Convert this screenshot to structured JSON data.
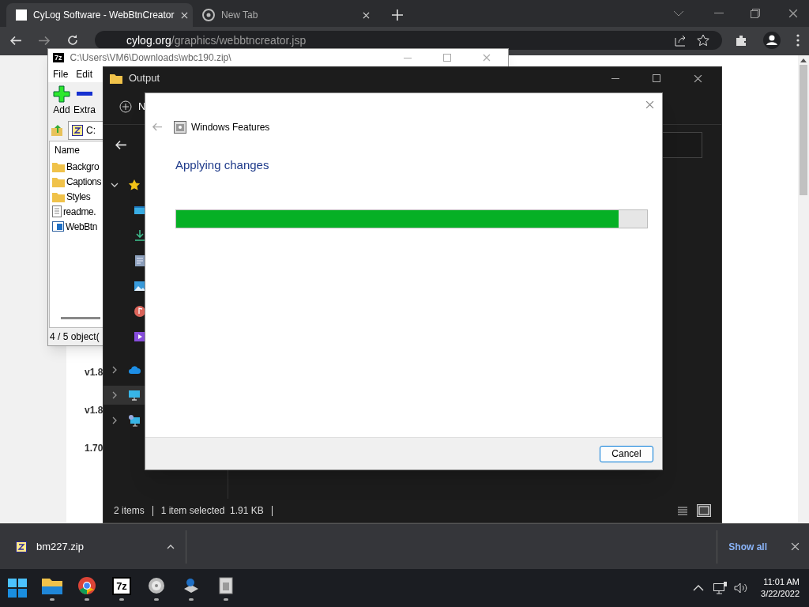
{
  "browser": {
    "tabs": [
      {
        "title": "CyLog Software - WebBtnCreator",
        "selected": true
      },
      {
        "title": "New Tab",
        "selected": false
      }
    ],
    "url_host": "cylog.org",
    "url_path": "/graphics/webbtncreator.jsp",
    "page_texts": [
      "v1.8",
      "v1.8",
      "1.70"
    ]
  },
  "archive_window": {
    "icon_label": "7z",
    "title": "C:\\Users\\VM6\\Downloads\\wbc190.zip\\",
    "menu": [
      "File",
      "Edit"
    ],
    "toolbar": [
      {
        "label": "Add",
        "kind": "add"
      },
      {
        "label": "Extra",
        "kind": "extract"
      }
    ],
    "address": "C:",
    "column": "Name",
    "items": [
      {
        "name": "Backgro",
        "kind": "folder"
      },
      {
        "name": "Captions",
        "kind": "folder"
      },
      {
        "name": "Styles",
        "kind": "folder"
      },
      {
        "name": "readme.",
        "kind": "text"
      },
      {
        "name": "WebBtn",
        "kind": "app"
      }
    ],
    "status": "4 / 5 object("
  },
  "explorer": {
    "title": "Output",
    "new_button": "N",
    "nav": [
      {
        "kind": "star",
        "expanded": true,
        "selected": false
      },
      {
        "kind": "desktop",
        "selected": false
      },
      {
        "kind": "download",
        "selected": false
      },
      {
        "kind": "document",
        "selected": false
      },
      {
        "kind": "pictures",
        "selected": false
      },
      {
        "kind": "music",
        "selected": false
      },
      {
        "kind": "videos",
        "selected": false
      },
      {
        "kind": "cloud",
        "expanded": false,
        "selected": false
      },
      {
        "kind": "pc",
        "expanded": false,
        "selected": true
      },
      {
        "kind": "network",
        "expanded": false,
        "selected": false
      }
    ],
    "status": [
      "2 items",
      "1 item selected  1.91 KB"
    ]
  },
  "dialog": {
    "title": "Windows Features",
    "heading": "Applying changes",
    "progress": {
      "level": 0.94
    },
    "buttons": [
      "Cancel"
    ]
  },
  "downloads": {
    "file": "bm227.zip",
    "show_all": "Show all"
  },
  "taskbar": {
    "apps": [
      {
        "kind": "folder"
      },
      {
        "kind": "chrome"
      },
      {
        "kind": "sevenzip",
        "label": "7z"
      },
      {
        "kind": "disc"
      },
      {
        "kind": "installer"
      },
      {
        "kind": "archive"
      }
    ],
    "time": "11:01 AM",
    "date": "3/22/2022"
  }
}
